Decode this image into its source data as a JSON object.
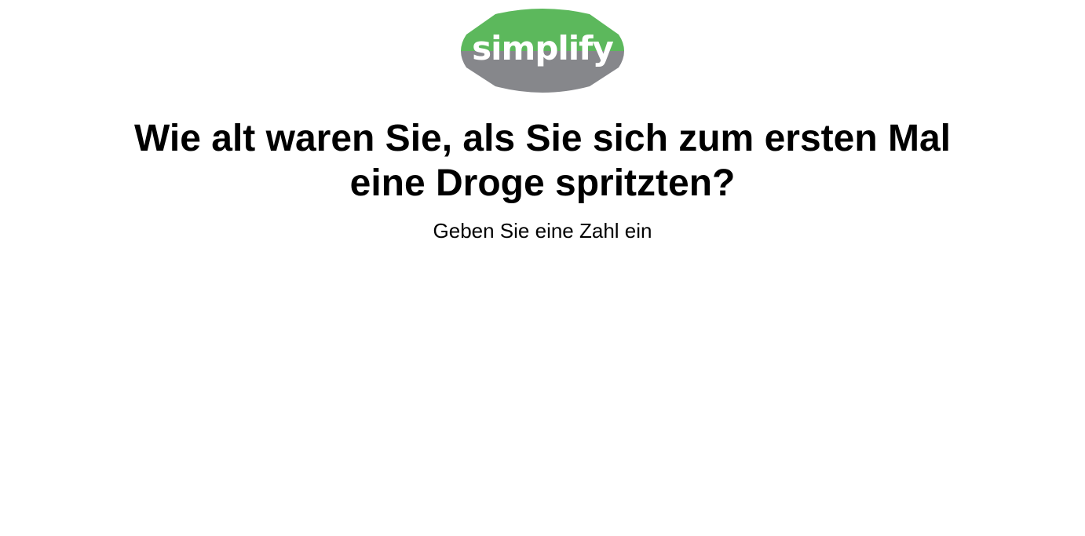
{
  "logo": {
    "text": "simplify",
    "colors": {
      "top": "#5cb85c",
      "bottom": "#86878b",
      "text": "#ffffff"
    }
  },
  "question": {
    "line1": "Wie alt waren Sie, als Sie sich zum ersten Mal",
    "line2": "eine Droge spritzten?"
  },
  "hint": "Geben Sie eine Zahl ein"
}
